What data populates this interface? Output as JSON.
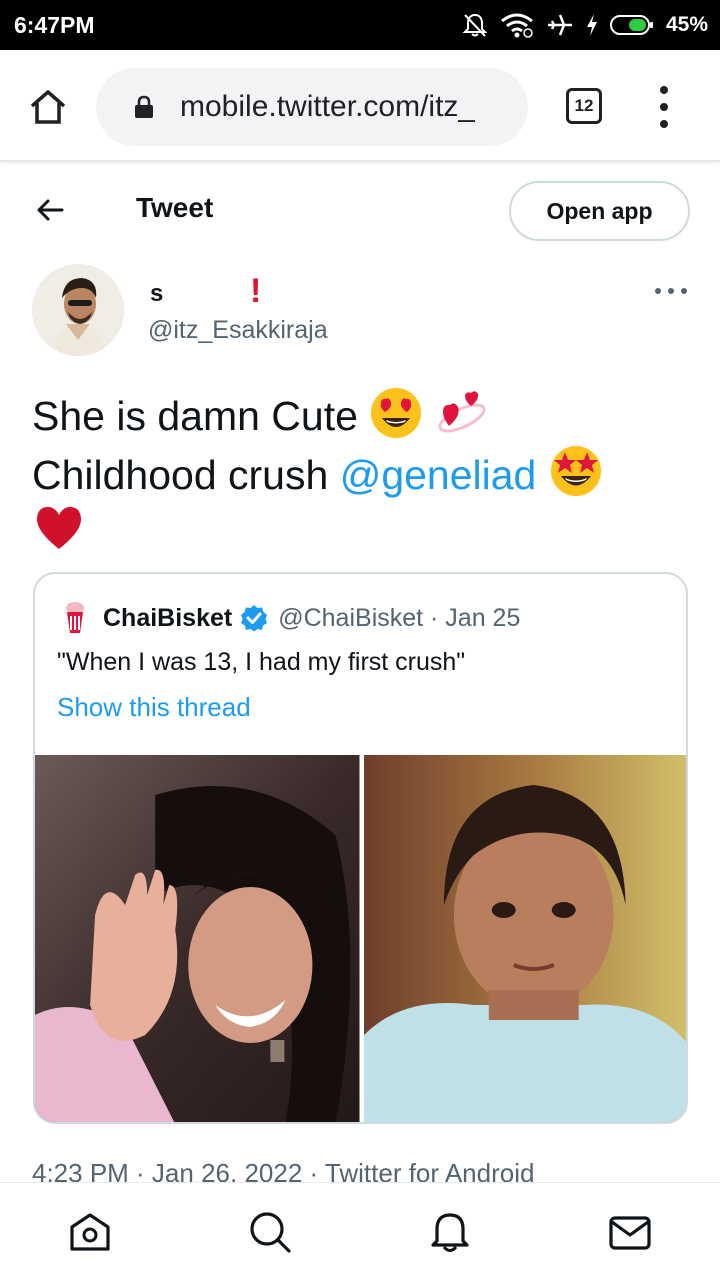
{
  "status_bar": {
    "time": "6:47PM",
    "battery_percent": "45%",
    "icons": [
      "mute-icon",
      "wifi-icon",
      "airplane-icon",
      "charging-icon",
      "battery-icon"
    ]
  },
  "browser": {
    "url": "mobile.twitter.com/itz_",
    "tab_count": "12"
  },
  "header": {
    "title": "Tweet",
    "open_app_label": "Open app"
  },
  "tweet": {
    "author": {
      "display_name": "s",
      "name_decoration": "!",
      "handle": "@itz_Esakkiraja"
    },
    "text": {
      "line1": "She is damn Cute",
      "line2": "Childhood crush",
      "mention": "@geneliad"
    },
    "emojis": [
      "heart-eyes-emoji",
      "revolving-hearts-emoji",
      "star-struck-emoji",
      "red-heart-emoji"
    ],
    "meta": "4:23 PM · Jan 26, 2022 · Twitter for Android"
  },
  "quote": {
    "name": "ChaiBisket",
    "handle_date": "@ChaiBisket · Jan 25",
    "text": "\"When I was 13, I had my first crush\"",
    "show_thread": "Show this thread",
    "verified": true
  },
  "bottom_nav": [
    "home-icon",
    "search-icon",
    "notifications-icon",
    "messages-icon"
  ],
  "colors": {
    "accent": "#1d9bf0",
    "text_primary": "#0f1419",
    "text_secondary": "#536471",
    "border": "#cfd9de"
  }
}
